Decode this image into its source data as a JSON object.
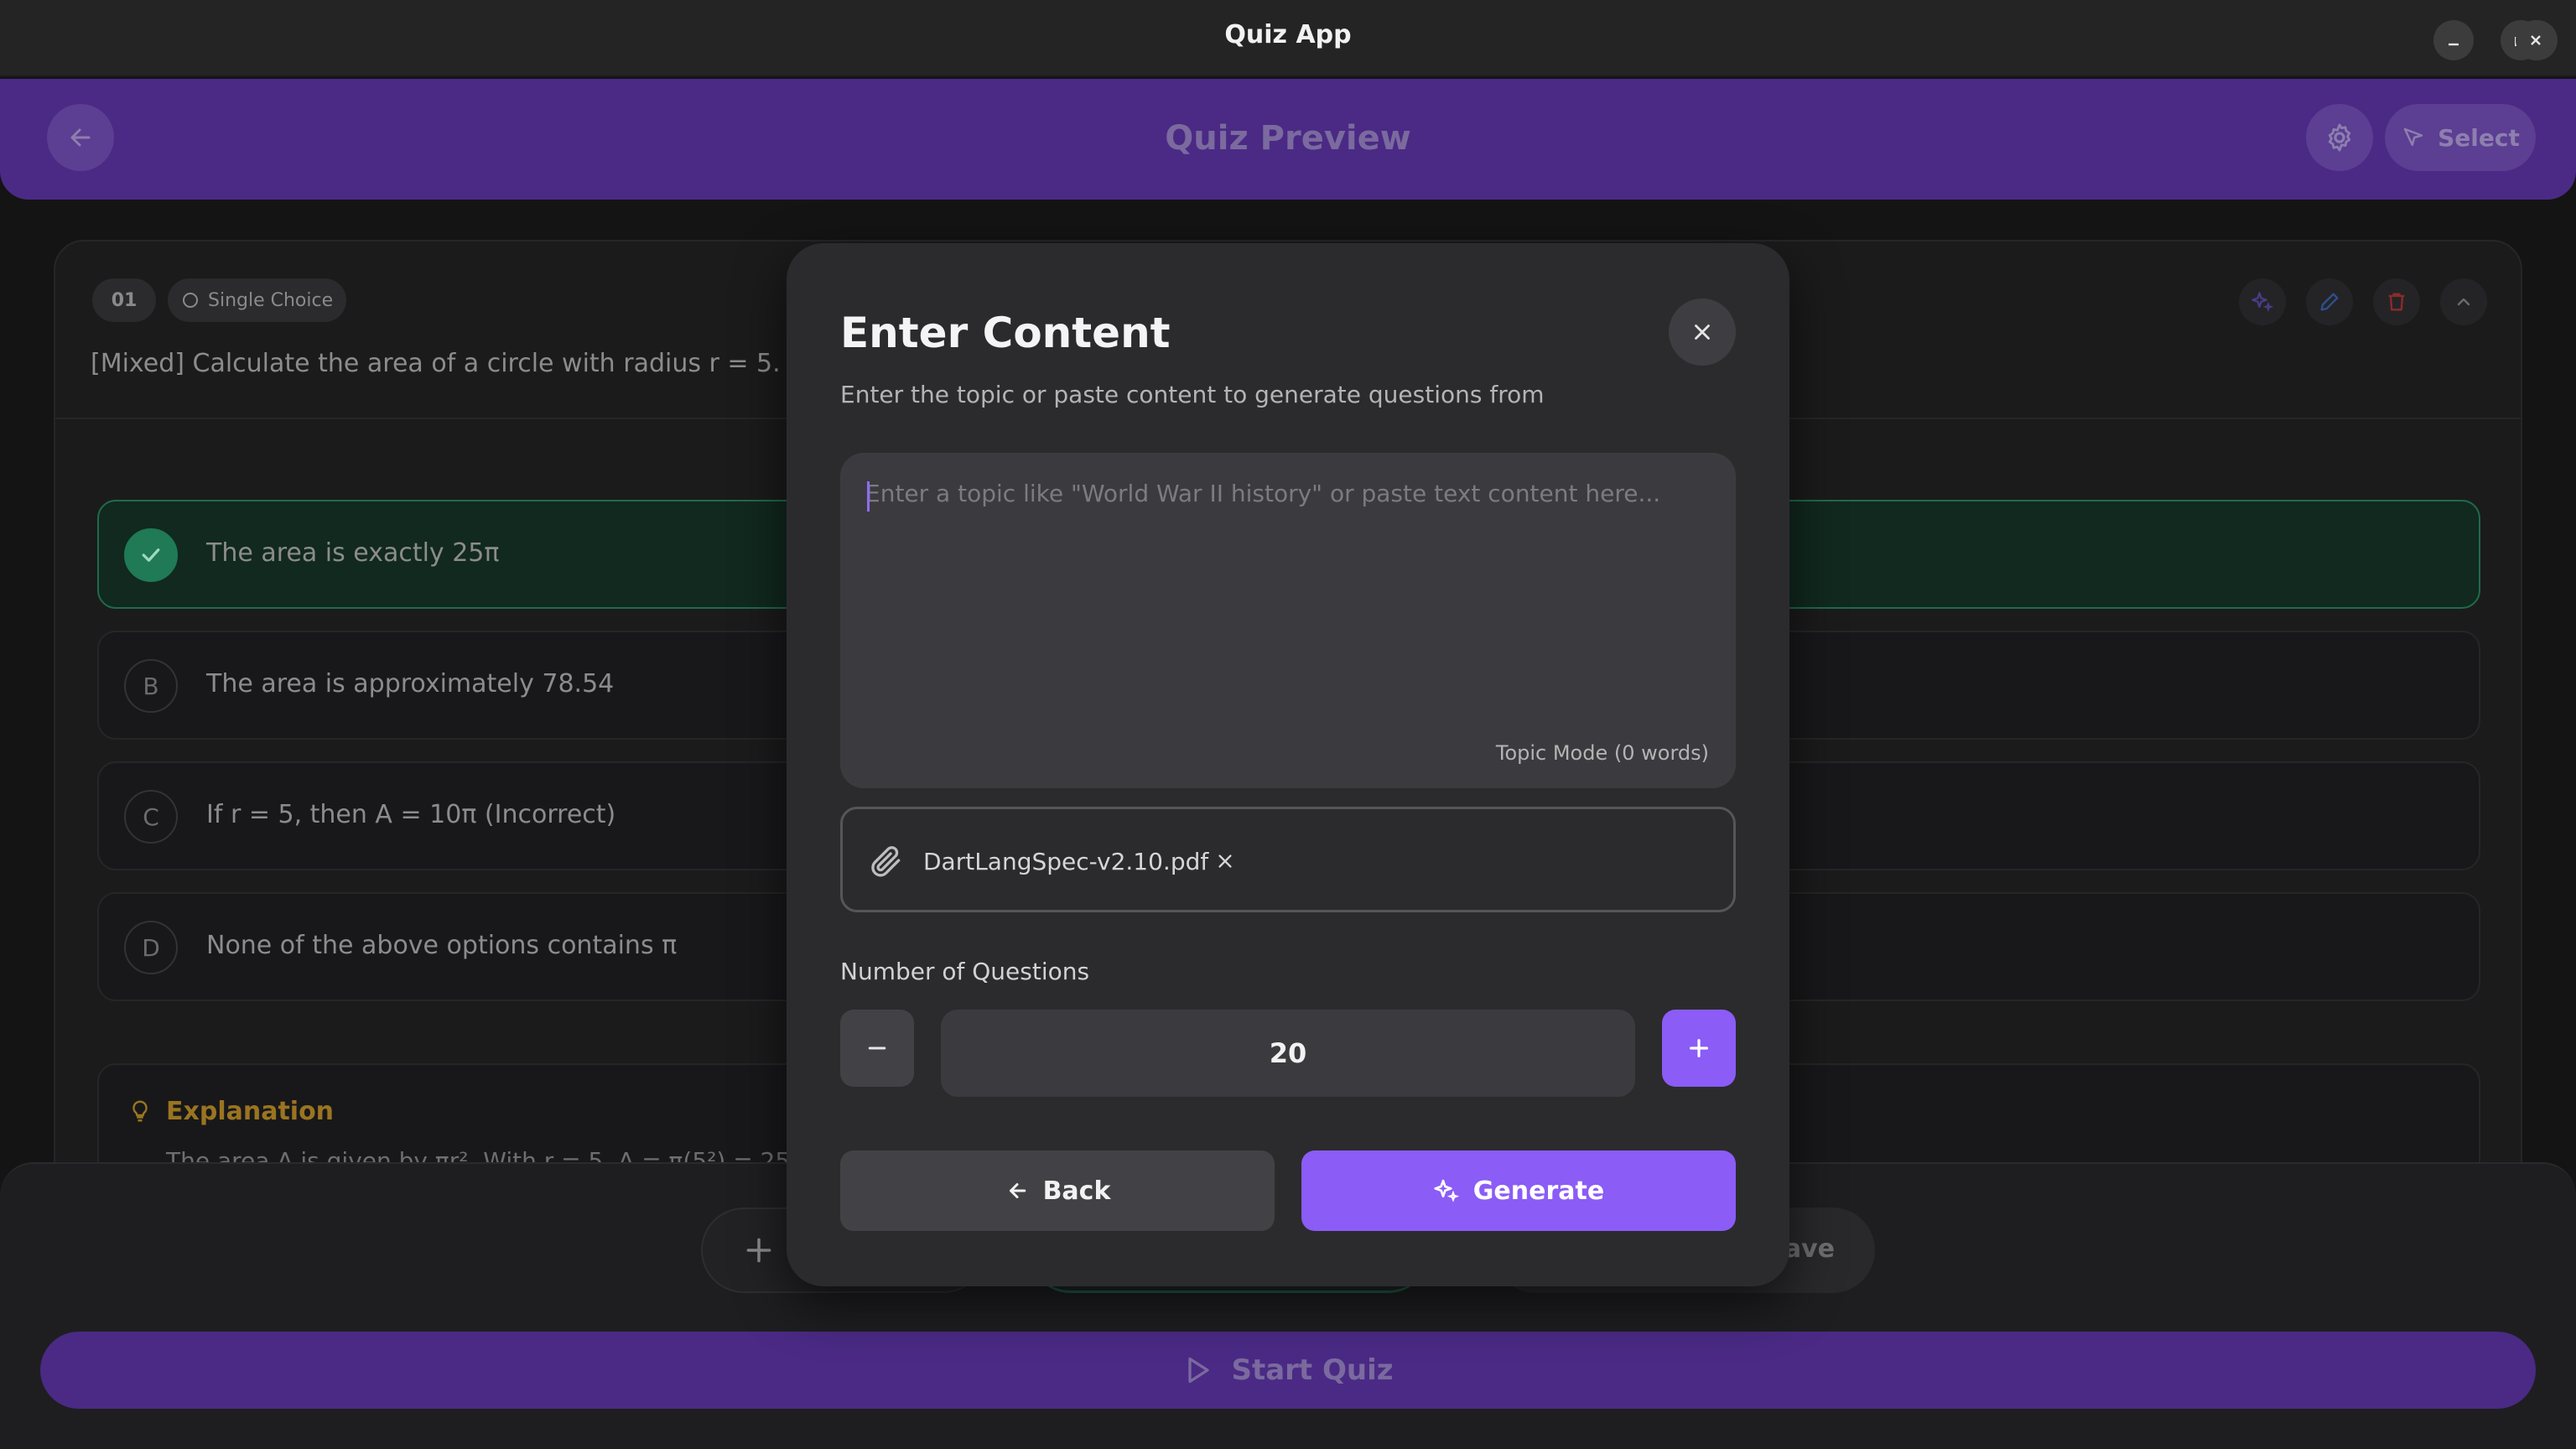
{
  "window": {
    "title": "Quiz App",
    "controls": [
      "minimize-icon",
      "restore-icon",
      "close-icon"
    ]
  },
  "header": {
    "title": "Quiz Preview",
    "back_icon": "arrow-left-icon",
    "settings_icon": "gear-icon",
    "select_label": "Select",
    "select_icon": "cursor-pointer-icon"
  },
  "question": {
    "number": "01",
    "type_label": "Single Choice",
    "text": "[Mixed] Calculate the area of a circle with radius r = 5. Use",
    "actions": [
      "sparkles-icon",
      "pencil-icon",
      "trash-icon",
      "chevron-up-icon"
    ],
    "options": [
      {
        "letter": "A",
        "text": "The area is exactly 25π",
        "correct": true
      },
      {
        "letter": "B",
        "text": "The area is approximately 78.54",
        "correct": false
      },
      {
        "letter": "C",
        "text": "If r = 5, then A = 10π (Incorrect)",
        "correct": false
      },
      {
        "letter": "D",
        "text": "None of the above options contains π",
        "correct": false
      }
    ],
    "explanation_title": "Explanation",
    "explanation_text": "The area A is given by πr². With r = 5, A = π(5²) = 25π"
  },
  "bottom_bar": {
    "save_label": "Save",
    "start_label": "Start Quiz"
  },
  "modal": {
    "title": "Enter Content",
    "subtitle": "Enter the topic or paste content to generate questions from",
    "input_placeholder": "Enter a topic like \"World War II history\" or paste text content here...",
    "input_value": "",
    "mode_label": "Topic Mode (0 words)",
    "file_name": "DartLangSpec-v2.10.pdf",
    "num_questions_label": "Number of Questions",
    "num_questions_value": "20",
    "back_label": "Back",
    "generate_label": "Generate"
  },
  "colors": {
    "accent": "#8b5cf6",
    "header_bg": "#4a2a85",
    "correct": "#1f7a55",
    "explanation": "#9a7420",
    "delete": "#8b2b2b"
  }
}
